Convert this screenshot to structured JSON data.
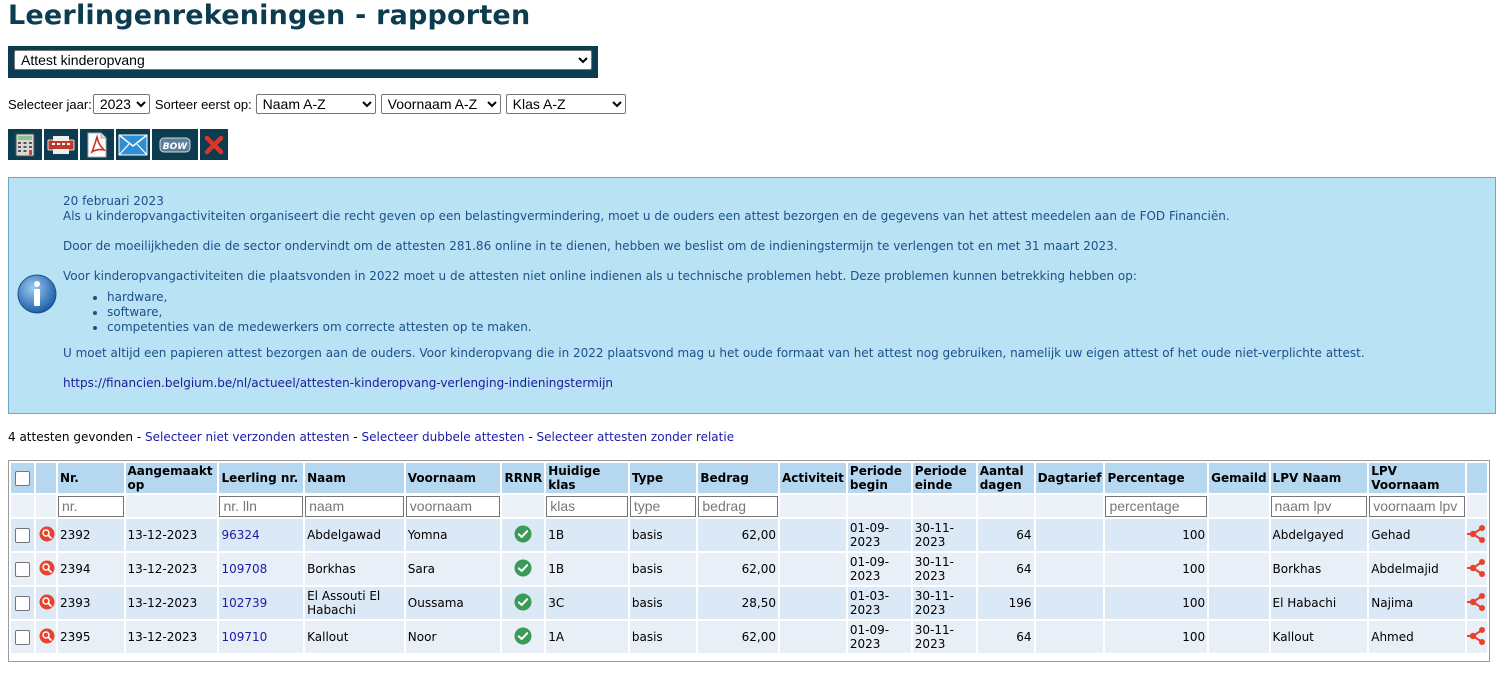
{
  "page": {
    "title": "Leerlingenrekeningen - rapporten",
    "report_type": "Attest kinderopvang"
  },
  "filters": {
    "year_label": "Selecteer jaar:",
    "year_value": "2023",
    "sort_label": "Sorteer eerst op:",
    "sort1": "Naam A-Z",
    "sort2": "Voornaam A-Z",
    "sort3": "Klas A-Z"
  },
  "toolbar": {
    "icons": [
      "calculator-icon",
      "print-icon",
      "pdf-icon",
      "mail-icon",
      "bow-icon",
      "delete-icon"
    ],
    "bow_label": "BOW"
  },
  "info": {
    "date": "20 februari 2023",
    "p1": "Als u kinderopvangactiviteiten organiseert die recht geven op een belastingvermindering, moet u de ouders een attest bezorgen en de gegevens van het attest meedelen aan de FOD Financiën.",
    "p2": "Door de moeilijkheden die de sector ondervindt om de attesten 281.86 online in te dienen, hebben we beslist om de indieningstermijn te verlengen tot en met 31 maart 2023.",
    "p3": "Voor kinderopvangactiviteiten die plaatsvonden in 2022 moet u de attesten niet online indienen als u technische problemen hebt. Deze problemen kunnen betrekking hebben op:",
    "bullets": [
      "hardware,",
      "software,",
      "competenties van de medewerkers om correcte attesten op te maken."
    ],
    "p4": "U moet altijd een papieren attest bezorgen aan de ouders. Voor kinderopvang die in 2022 plaatsvond mag u het oude formaat van het attest nog gebruiken, namelijk uw eigen attest of het oude niet-verplichte attest.",
    "link": "https://financien.belgium.be/nl/actueel/attesten-kinderopvang-verlenging-indieningstermijn"
  },
  "results": {
    "count_text": "4 attesten gevonden",
    "sep": " - ",
    "link1": "Selecteer niet verzonden attesten",
    "link2": "Selecteer dubbele attesten",
    "link3": "Selecteer attesten zonder relatie"
  },
  "table": {
    "headers": {
      "nr": "Nr.",
      "aangemaakt": "Aangemaakt op",
      "leerling_nr": "Leerling nr.",
      "naam": "Naam",
      "voornaam": "Voornaam",
      "rrnr": "RRNR",
      "klas": "Huidige klas",
      "type": "Type",
      "bedrag": "Bedrag",
      "activiteit": "Activiteit",
      "periode_begin": "Periode begin",
      "periode_einde": "Periode einde",
      "aantal_dagen": "Aantal dagen",
      "dagtarief": "Dagtarief",
      "percentage": "Percentage",
      "gemaild": "Gemaild",
      "lpv_naam": "LPV Naam",
      "lpv_voornaam": "LPV Voornaam"
    },
    "placeholders": {
      "nr": "nr.",
      "leerling_nr": "nr. lln",
      "naam": "naam",
      "voornaam": "voornaam",
      "klas": "klas",
      "type": "type",
      "bedrag": "bedrag",
      "percentage": "percentage",
      "lpv_naam": "naam lpv",
      "lpv_voornaam": "voornaam lpv"
    },
    "rows": [
      {
        "nr": "2392",
        "aangemaakt": "13-12-2023",
        "leerling_nr": "96324",
        "naam": "Abdelgawad",
        "voornaam": "Yomna",
        "rrnr_ok": true,
        "klas": "1B",
        "type": "basis",
        "bedrag": "62,00",
        "activiteit": "",
        "periode_begin": "01-09-2023",
        "periode_einde": "30-11-2023",
        "aantal_dagen": "64",
        "dagtarief": "",
        "percentage": "100",
        "gemaild": "",
        "lpv_naam": "Abdelgayed",
        "lpv_voornaam": "Gehad"
      },
      {
        "nr": "2394",
        "aangemaakt": "13-12-2023",
        "leerling_nr": "109708",
        "naam": "Borkhas",
        "voornaam": "Sara",
        "rrnr_ok": true,
        "klas": "1B",
        "type": "basis",
        "bedrag": "62,00",
        "activiteit": "",
        "periode_begin": "01-09-2023",
        "periode_einde": "30-11-2023",
        "aantal_dagen": "64",
        "dagtarief": "",
        "percentage": "100",
        "gemaild": "",
        "lpv_naam": "Borkhas",
        "lpv_voornaam": "Abdelmajid"
      },
      {
        "nr": "2393",
        "aangemaakt": "13-12-2023",
        "leerling_nr": "102739",
        "naam": "El Assouti El Habachi",
        "voornaam": "Oussama",
        "rrnr_ok": true,
        "klas": "3C",
        "type": "basis",
        "bedrag": "28,50",
        "activiteit": "",
        "periode_begin": "01-03-2023",
        "periode_einde": "30-11-2023",
        "aantal_dagen": "196",
        "dagtarief": "",
        "percentage": "100",
        "gemaild": "",
        "lpv_naam": "El Habachi",
        "lpv_voornaam": "Najima"
      },
      {
        "nr": "2395",
        "aangemaakt": "13-12-2023",
        "leerling_nr": "109710",
        "naam": "Kallout",
        "voornaam": "Noor",
        "rrnr_ok": true,
        "klas": "1A",
        "type": "basis",
        "bedrag": "62,00",
        "activiteit": "",
        "periode_begin": "01-09-2023",
        "periode_einde": "30-11-2023",
        "aantal_dagen": "64",
        "dagtarief": "",
        "percentage": "100",
        "gemaild": "",
        "lpv_naam": "Kallout",
        "lpv_voornaam": "Ahmed"
      }
    ]
  },
  "colors": {
    "title": "#0b3c4f",
    "info_bg": "#b9e3f4",
    "header_bg": "#b6d7f0",
    "link": "#1a1aa8",
    "detail_icon": "#e8412c",
    "share_icon": "#e8412c",
    "check_icon": "#3a9a58"
  }
}
